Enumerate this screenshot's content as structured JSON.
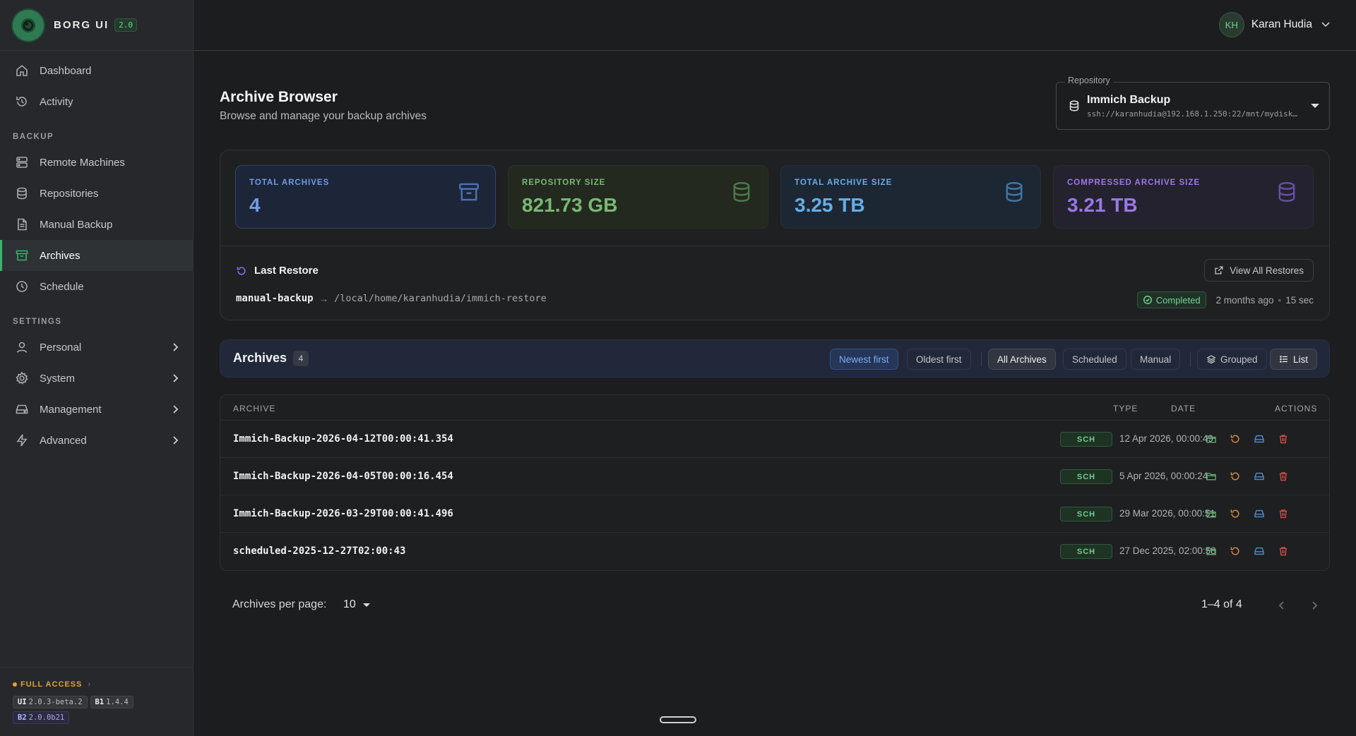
{
  "brand": {
    "name": "BORG UI",
    "version": "2.0"
  },
  "sidebar": {
    "top_items": [
      {
        "label": "Dashboard",
        "icon": "home-icon"
      },
      {
        "label": "Activity",
        "icon": "history-icon"
      }
    ],
    "sections": [
      {
        "title": "BACKUP"
      },
      {
        "title": "SETTINGS"
      }
    ],
    "backup_items": [
      {
        "label": "Remote Machines",
        "icon": "server-icon"
      },
      {
        "label": "Repositories",
        "icon": "database-icon"
      },
      {
        "label": "Manual Backup",
        "icon": "file-icon"
      },
      {
        "label": "Archives",
        "icon": "archive-icon",
        "active": true
      },
      {
        "label": "Schedule",
        "icon": "clock-icon"
      }
    ],
    "settings_items": [
      {
        "label": "Personal",
        "icon": "user-icon"
      },
      {
        "label": "System",
        "icon": "gear-icon"
      },
      {
        "label": "Management",
        "icon": "drive-icon"
      },
      {
        "label": "Advanced",
        "icon": "bolt-icon"
      }
    ],
    "footer": {
      "access": "FULL ACCESS",
      "versions": [
        {
          "key": "UI",
          "value": "2.0.3-beta.2"
        },
        {
          "key": "B1",
          "value": "1.4.4"
        },
        {
          "key": "B2",
          "value": "2.0.0b21"
        }
      ]
    }
  },
  "user": {
    "initials": "KH",
    "name": "Karan Hudia"
  },
  "page": {
    "title": "Archive Browser",
    "subtitle": "Browse and manage your backup archives"
  },
  "repository": {
    "legend": "Repository",
    "name": "Immich Backup",
    "url": "ssh://karanhudia@192.168.1.250:22/mnt/mydisk…"
  },
  "stats": [
    {
      "label": "TOTAL ARCHIVES",
      "value": "4",
      "icon": "archive-icon",
      "color": "#6f9ce8"
    },
    {
      "label": "REPOSITORY SIZE",
      "value": "821.73 GB",
      "icon": "database-icon",
      "color": "#78b873"
    },
    {
      "label": "TOTAL ARCHIVE SIZE",
      "value": "3.25 TB",
      "icon": "database-icon",
      "color": "#64aee8"
    },
    {
      "label": "COMPRESSED ARCHIVE SIZE",
      "value": "3.21 TB",
      "icon": "database-icon",
      "color": "#9b77e8"
    }
  ],
  "last_restore": {
    "title": "Last Restore",
    "view_all": "View All Restores",
    "archive": "manual-backup",
    "arrow": "→",
    "path": "/local/home/karanhudia/immich-restore",
    "status": "Completed",
    "when": "2 months ago",
    "duration": "15 sec"
  },
  "archives_toolbar": {
    "title": "Archives",
    "count": "4",
    "sort": {
      "newest": "Newest first",
      "oldest": "Oldest first"
    },
    "filters": {
      "all": "All Archives",
      "scheduled": "Scheduled",
      "manual": "Manual"
    },
    "views": {
      "grouped": "Grouped",
      "list": "List"
    }
  },
  "table": {
    "headers": {
      "archive": "ARCHIVE",
      "type": "TYPE",
      "date": "DATE",
      "actions": "ACTIONS"
    },
    "rows": [
      {
        "name": "Immich-Backup-2026-04-12T00:00:41.354",
        "type": "SCH",
        "date": "12 Apr 2026, 00:00:49"
      },
      {
        "name": "Immich-Backup-2026-04-05T00:00:16.454",
        "type": "SCH",
        "date": "5 Apr 2026, 00:00:24"
      },
      {
        "name": "Immich-Backup-2026-03-29T00:00:41.496",
        "type": "SCH",
        "date": "29 Mar 2026, 00:00:51"
      },
      {
        "name": "scheduled-2025-12-27T02:00:43",
        "type": "SCH",
        "date": "27 Dec 2025, 02:00:58"
      }
    ]
  },
  "pagination": {
    "label": "Archives per page:",
    "per_page": "10",
    "range": "1–4 of 4"
  }
}
